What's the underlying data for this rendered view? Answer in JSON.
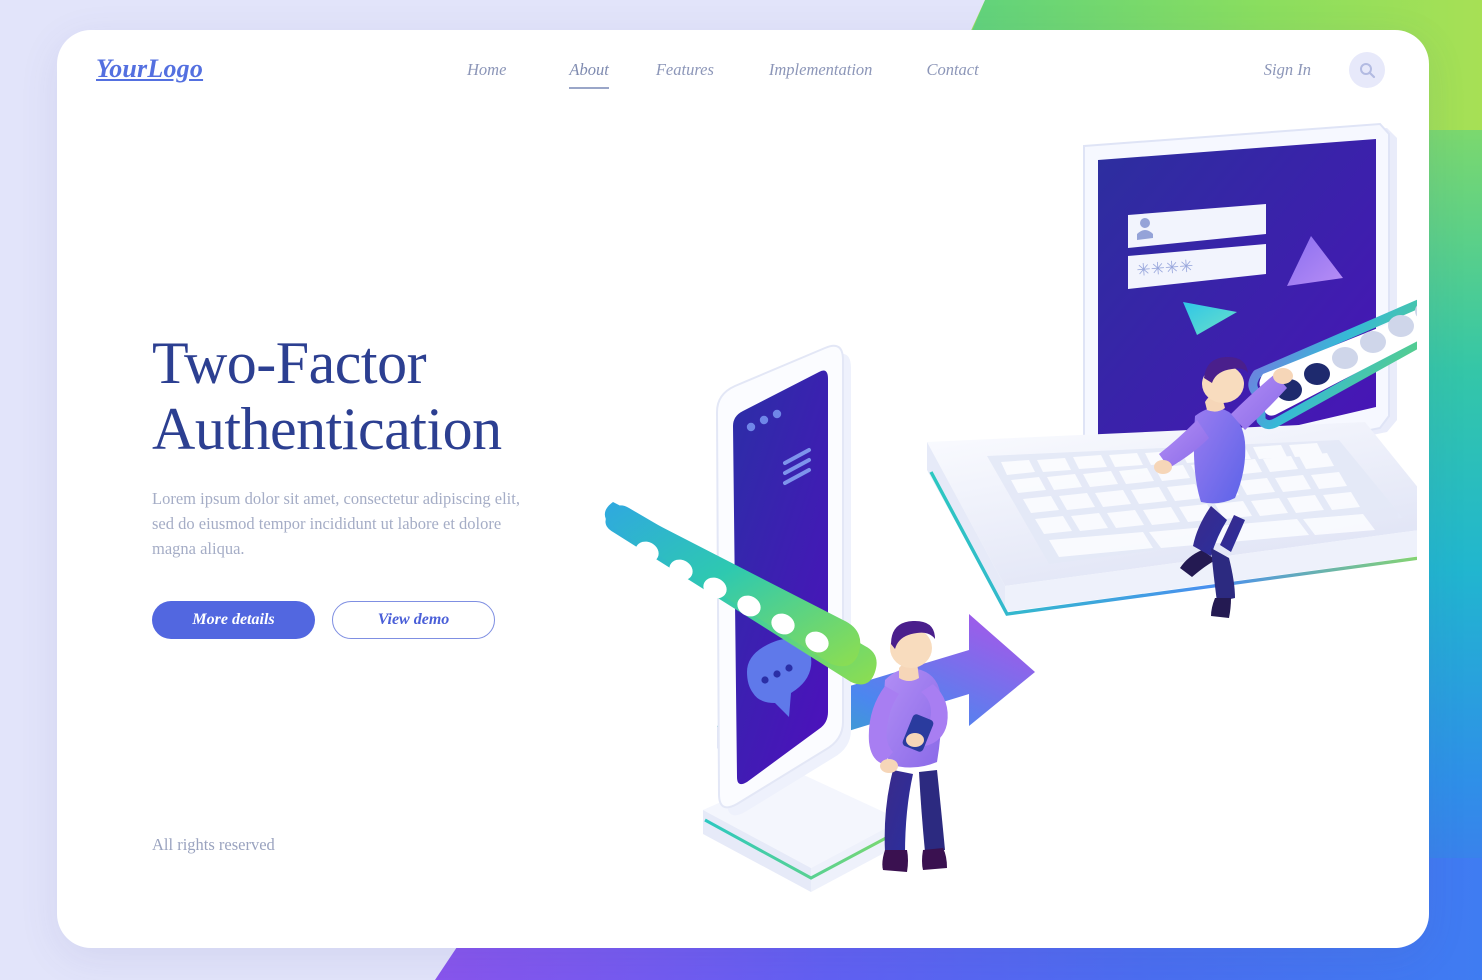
{
  "brand": {
    "logo": "YourLogo"
  },
  "nav": {
    "items": [
      {
        "label": "Home",
        "active": false
      },
      {
        "label": "About",
        "active": true
      },
      {
        "label": "Features",
        "active": false
      },
      {
        "label": "Implementation",
        "active": false
      },
      {
        "label": "Contact",
        "active": false
      }
    ],
    "sign_in": "Sign In",
    "search_icon": "search-icon"
  },
  "hero": {
    "title_line1": "Two-Factor",
    "title_line2": "Authentication",
    "paragraph": "Lorem ipsum dolor sit amet, consectetur adipiscing elit, sed do eiusmod tempor incididunt ut labore et dolore magna aliqua.",
    "primary_button": "More details",
    "secondary_button": "View demo"
  },
  "footer": {
    "rights": "All rights reserved"
  },
  "illustration": {
    "phone": {
      "screen_label": "SMS",
      "status_dots": 3,
      "menu_icon": "hamburger-menu-icon",
      "chat_icon": "chat-bubble-icon",
      "otp_dots": 6
    },
    "laptop": {
      "username_field_icon": "user-icon",
      "password_field_value": "****",
      "otp_dots": 6,
      "otp_filled_dots": 2,
      "triangle_down_icon": "triangle-down-icon",
      "triangle_up_icon": "triangle-up-icon"
    },
    "arrow_icon": "arrow-right-icon",
    "people": [
      {
        "name": "person-with-phone"
      },
      {
        "name": "person-reaching-otp"
      }
    ]
  },
  "colors": {
    "accent": "#5267e0",
    "heading": "#2c3f91",
    "muted": "#a5adc6",
    "page_bg": "#e2e4fa",
    "card_bg": "#ffffff",
    "teal": "#23bfae",
    "green": "#8ade5f",
    "purple": "#a04fe6",
    "deep_blue": "#2a1b8f"
  }
}
